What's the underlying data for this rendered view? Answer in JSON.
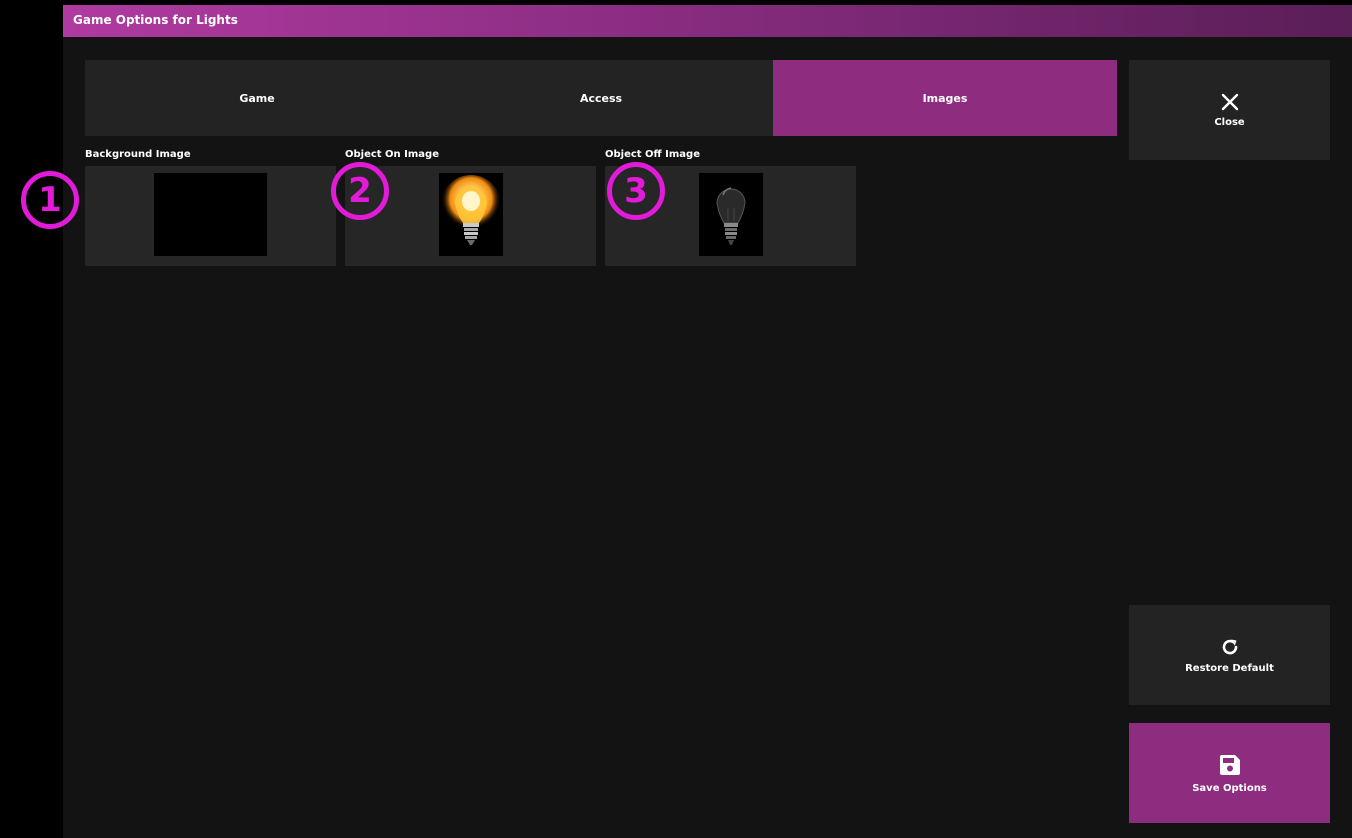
{
  "window": {
    "title": "Game Options for Lights"
  },
  "tabs": [
    {
      "label": "Game",
      "active": false
    },
    {
      "label": "Access",
      "active": false
    },
    {
      "label": "Images",
      "active": true
    }
  ],
  "images": [
    {
      "label": "Background Image",
      "thumb": "black-background"
    },
    {
      "label": "Object On Image",
      "thumb": "lit-lightbulb"
    },
    {
      "label": "Object Off Image",
      "thumb": "unlit-lightbulb"
    }
  ],
  "actions": {
    "close": {
      "label": "Close",
      "icon": "close-icon"
    },
    "restore": {
      "label": "Restore Default",
      "icon": "refresh-icon"
    },
    "save": {
      "label": "Save Options",
      "icon": "floppy-disk-icon"
    }
  },
  "markers": [
    "1",
    "2",
    "3"
  ],
  "colors": {
    "accent": "#8e2d80",
    "marker": "#e11bd8",
    "panel": "#232323",
    "background": "#131313"
  }
}
